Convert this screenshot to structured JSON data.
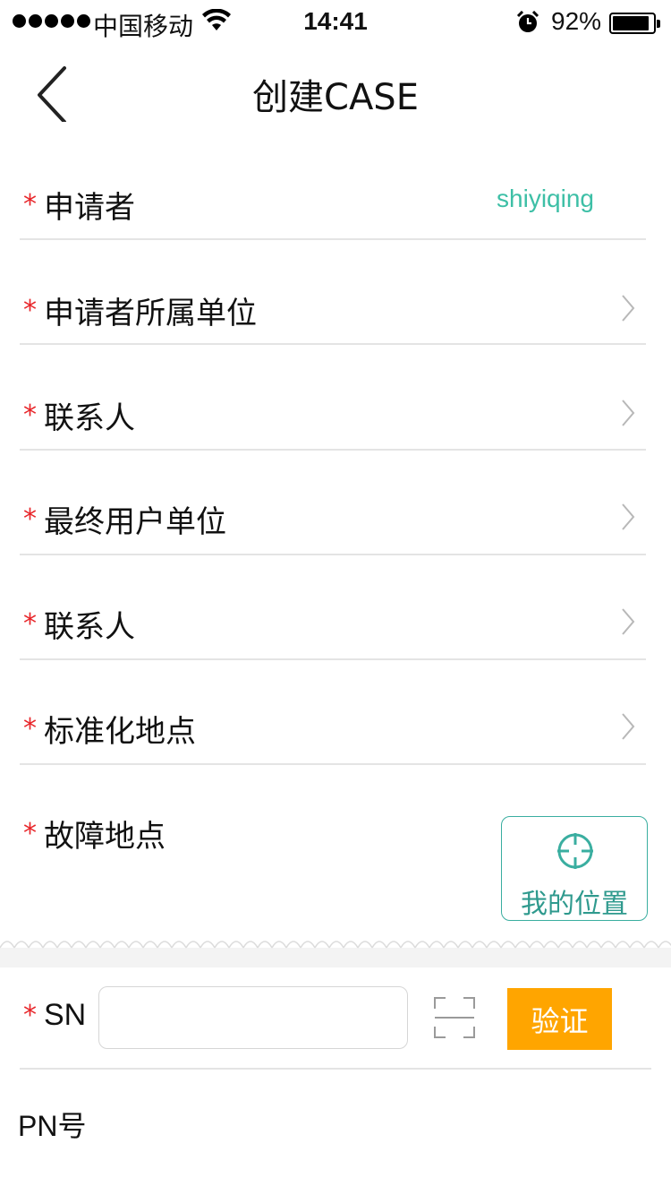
{
  "status_bar": {
    "carrier": "中国移动",
    "time": "14:41",
    "battery_percent": "92%",
    "battery_level": 0.92,
    "icons": [
      "signal-dots-icon",
      "wifi-icon",
      "alarm-icon",
      "battery-icon"
    ]
  },
  "nav": {
    "title": "创建CASE",
    "back_icon": "chevron-left-icon"
  },
  "form": {
    "required_mark": "*",
    "fields": [
      {
        "label": "申请者",
        "value": "shiyiqing"
      },
      {
        "label": "申请者所属单位"
      },
      {
        "label": "联系人"
      },
      {
        "label": "最终用户单位"
      },
      {
        "label": "联系人"
      },
      {
        "label": "标准化地点"
      },
      {
        "label": "故障地点"
      }
    ],
    "location_button": {
      "label": "我的位置",
      "icon": "crosshair-icon"
    },
    "sn": {
      "label": "SN",
      "value": "",
      "placeholder": "",
      "scan_icon": "scan-frame-icon",
      "verify_label": "验证"
    },
    "pn_label": "PN号"
  },
  "colors": {
    "accent_teal": "#3dbfa6",
    "required_red": "#e8262a",
    "verify_orange": "#ffa500",
    "divider": "#e4e4e4"
  }
}
